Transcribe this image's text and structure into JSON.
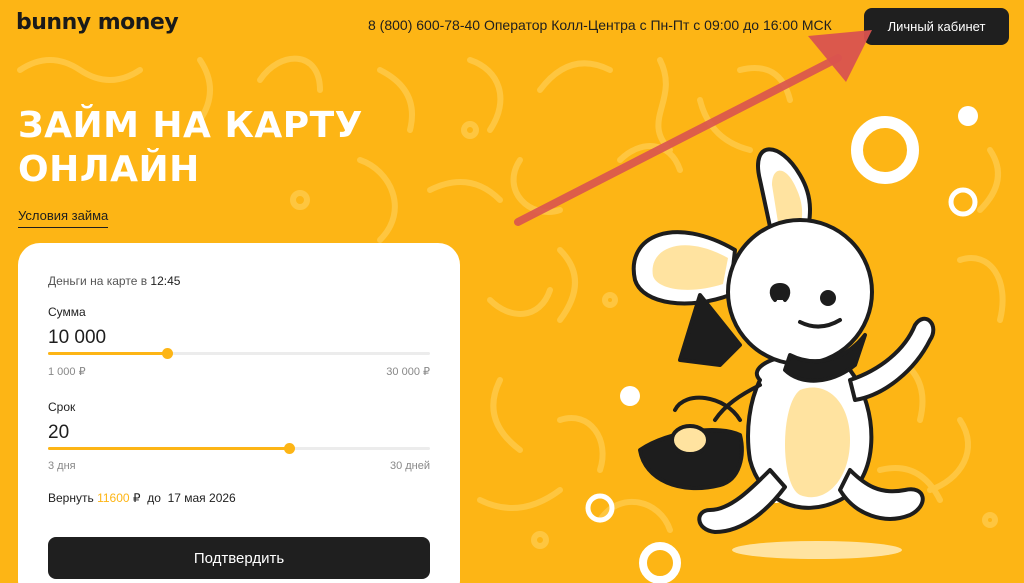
{
  "header": {
    "logo": "bunny money",
    "phone_text": "8 (800) 600-78-40 Оператор Колл-Центра с Пн-Пт с 09:00 до 16:00 МСК",
    "cabinet_button": "Личный кабинет"
  },
  "hero": {
    "title_line1": "ЗАЙМ НА КАРТУ",
    "title_line2": "ОНЛАЙН",
    "terms_link": "Условия займа"
  },
  "calculator": {
    "money_on_card_label": "Деньги на карте в",
    "money_on_card_time": "12:45",
    "amount": {
      "label": "Сумма",
      "value": "10 000",
      "min_label": "1 000 ₽",
      "max_label": "30 000 ₽",
      "min": 1000,
      "max": 30000,
      "current": 10000
    },
    "term": {
      "label": "Срок",
      "value": "20",
      "min_label": "3 дня",
      "max_label": "30 дней",
      "min": 3,
      "max": 30,
      "current": 20
    },
    "repay_label": "Вернуть",
    "repay_amount": "11600",
    "repay_currency": "₽",
    "repay_until": "до",
    "repay_date": "17 мая 2026",
    "confirm_button": "Подтвердить"
  },
  "colors": {
    "background": "#FDB515",
    "dark": "#1f1f1f",
    "accent": "#FDB515",
    "arrow": "#D9534F",
    "card": "#ffffff"
  },
  "icons": {
    "mascot": "bunny-mascot-illustration",
    "pointer": "red-arrow-annotation"
  }
}
